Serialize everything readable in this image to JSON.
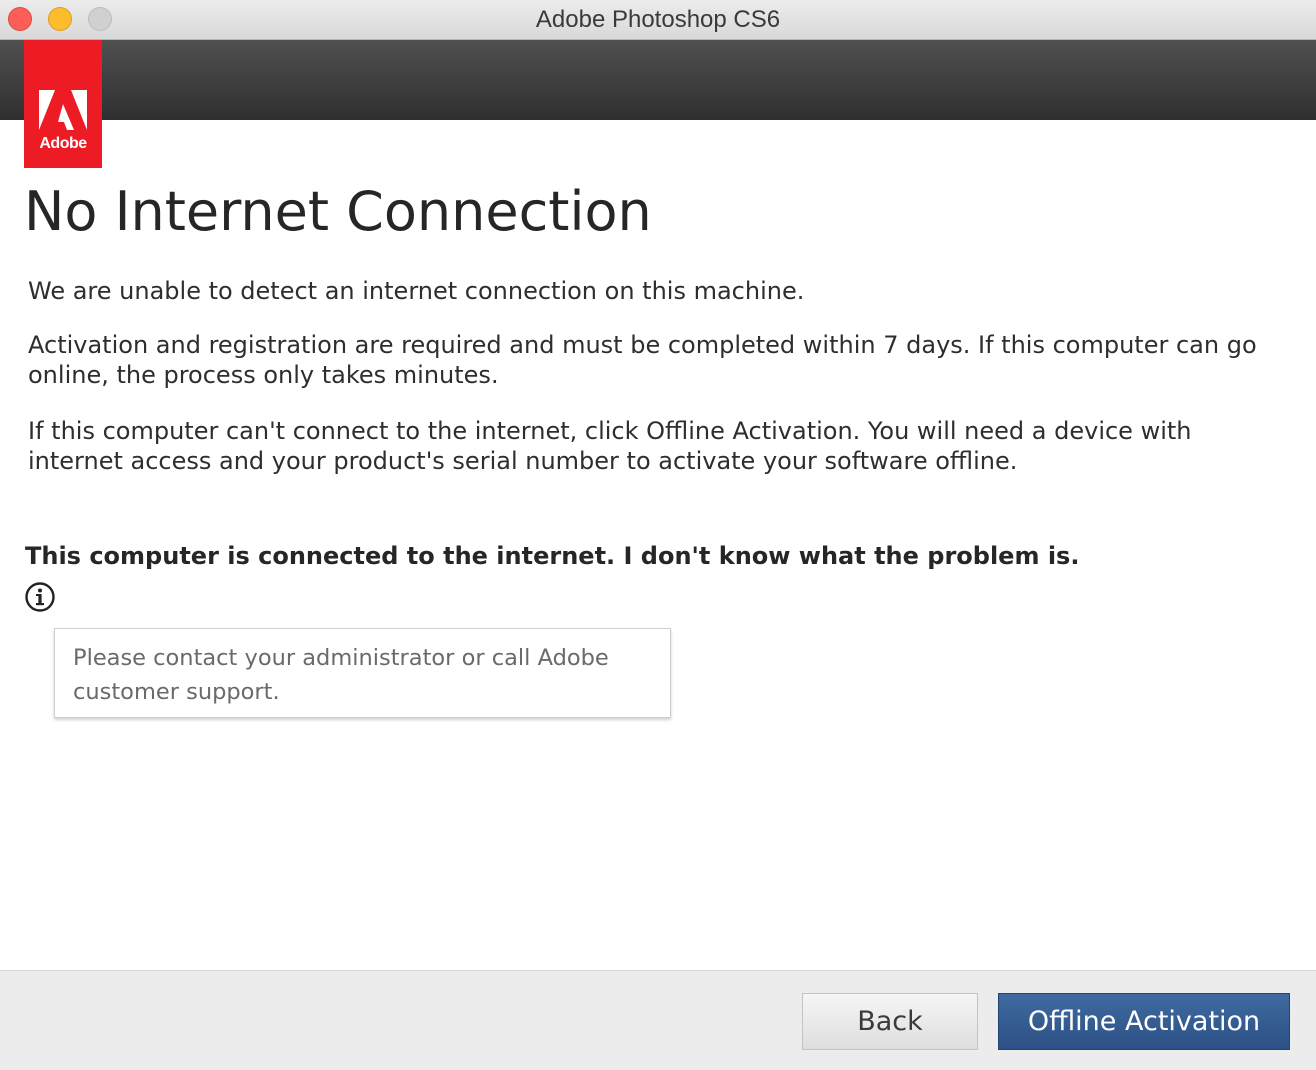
{
  "window": {
    "title": "Adobe Photoshop CS6"
  },
  "brand": {
    "logo_text": "Adobe",
    "logo_color": "#ed1c24"
  },
  "main": {
    "heading": "No Internet Connection",
    "paragraphs": [
      "We are unable to detect an internet connection on this machine.",
      "Activation and registration are required and must be completed within 7 days. If this computer can go online, the process only takes minutes.",
      "If this computer can't connect to the internet, click Offline Activation. You will need a device with internet access and your product's serial number to activate your software offline."
    ],
    "problem_link": "This computer is connected to the internet. I don't know what the problem is.",
    "info_icon": "info-icon",
    "tooltip_text": "Please contact your administrator or call Adobe customer support."
  },
  "footer": {
    "back_label": "Back",
    "offline_label": "Offline Activation",
    "primary_color": "#2c5186"
  }
}
